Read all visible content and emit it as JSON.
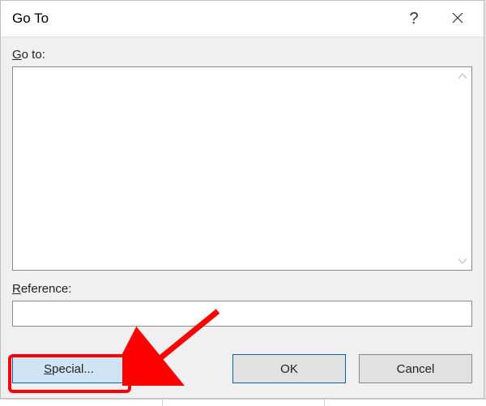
{
  "dialog": {
    "title": "Go To",
    "help_tooltip": "Help",
    "close_tooltip": "Close"
  },
  "labels": {
    "goto_prefix": "G",
    "goto_rest": "o to:",
    "reference_prefix": "R",
    "reference_rest": "eference:"
  },
  "fields": {
    "goto_list_items": [],
    "reference_value": ""
  },
  "buttons": {
    "special_prefix": "S",
    "special_rest": "pecial...",
    "ok": "OK",
    "cancel": "Cancel"
  },
  "annotation": {
    "target": "special-button",
    "color": "#fd0100"
  }
}
